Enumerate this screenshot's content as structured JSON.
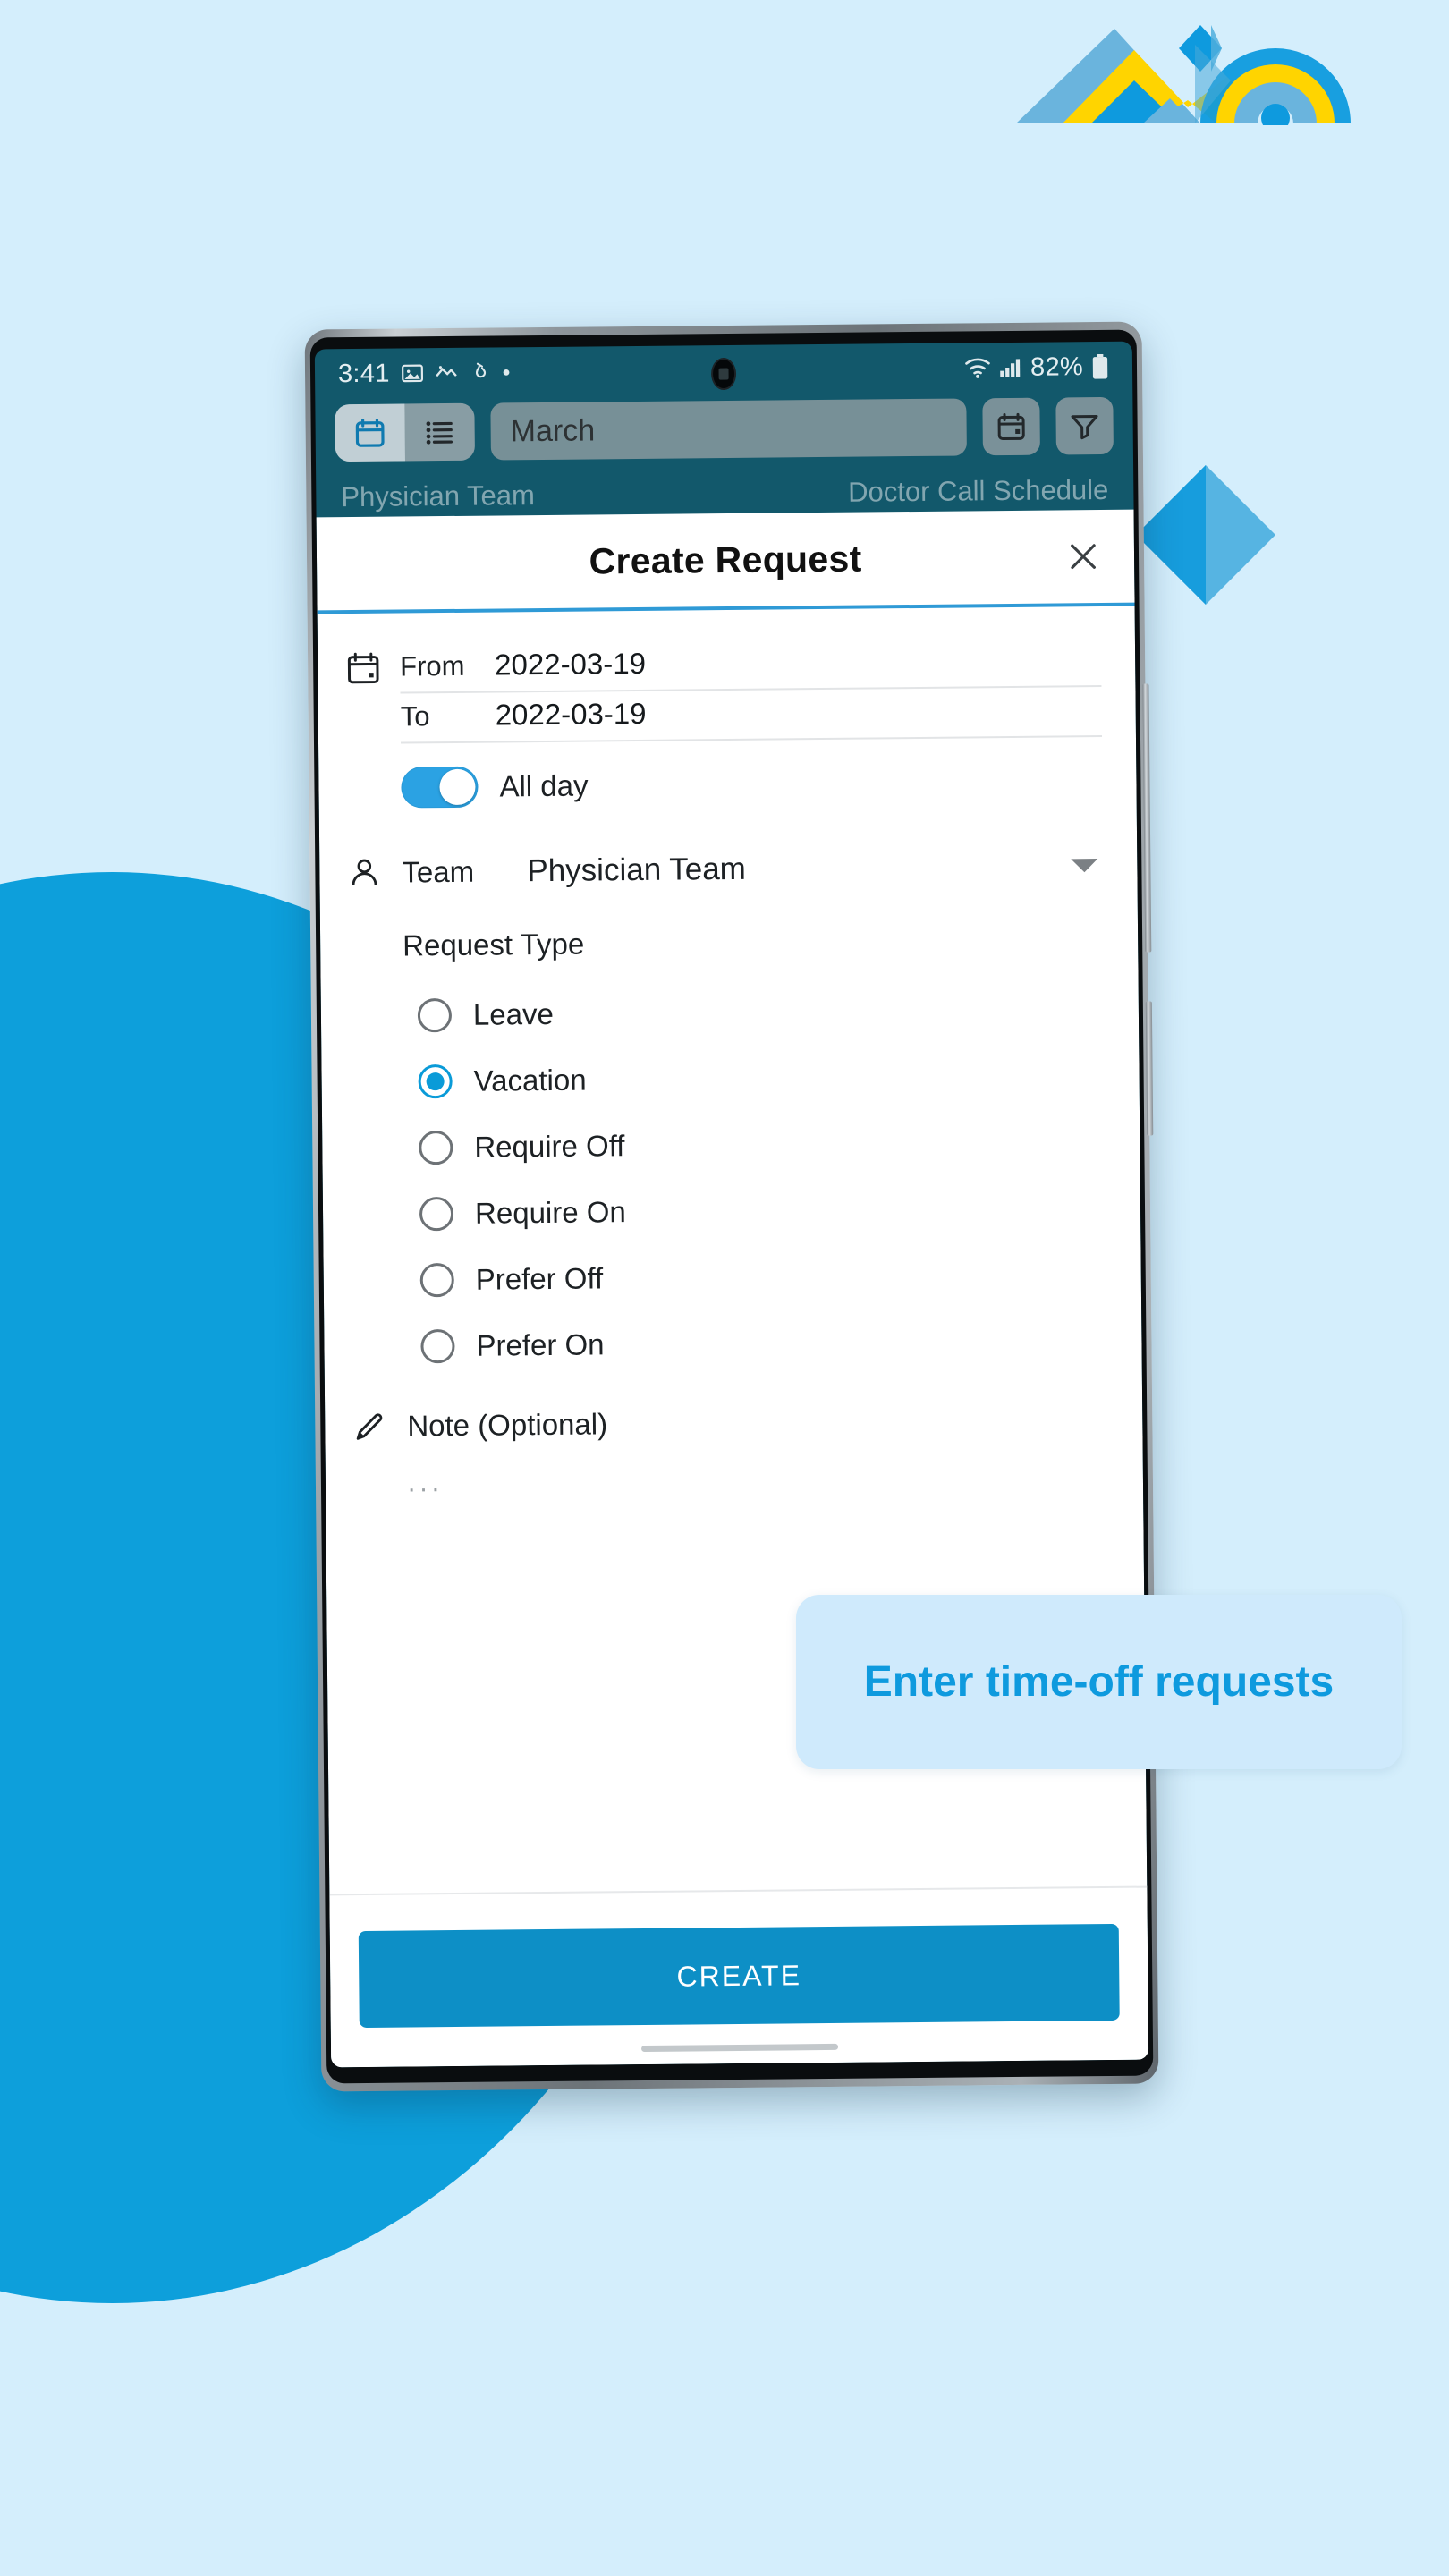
{
  "background": {
    "page_bg": "#d4eefc",
    "blob_color": "#0d9fdb",
    "accent_blue": "#0e9ade",
    "accent_yellow": "#ffd400"
  },
  "logo": {
    "name": "mountain-wave-logo",
    "colors": [
      "#6ab4dd",
      "#ffd400",
      "#0e9ade"
    ]
  },
  "phone": {
    "status_bar": {
      "time": "3:41",
      "icons": [
        "image-icon",
        "photo-editor-icon",
        "alarm-icon",
        "dot-icon"
      ],
      "wifi": "wifi-icon",
      "signal": "cellular-signal-icon",
      "battery_text": "82%",
      "battery": "battery-icon"
    },
    "toolbar": {
      "calendar_view_label": "calendar-view-icon",
      "list_view_label": "list-view-icon",
      "month_value": "March",
      "month_placeholder": "March",
      "date_picker_label": "date-picker-icon",
      "filter_label": "filter-icon"
    },
    "subheader": {
      "left": "Physician Team",
      "right": "Doctor Call Schedule"
    }
  },
  "modal": {
    "title": "Create Request",
    "close_label": "×",
    "date": {
      "icon": "calendar-icon",
      "from_label": "From",
      "from_value": "2022-03-19",
      "to_label": "To",
      "to_value": "2022-03-19"
    },
    "all_day": {
      "label": "All day",
      "enabled": true
    },
    "team": {
      "icon": "person-icon",
      "label": "Team",
      "value": "Physician Team"
    },
    "request_type": {
      "label": "Request Type",
      "selected": "Vacation",
      "options": [
        {
          "label": "Leave",
          "selected": false
        },
        {
          "label": "Vacation",
          "selected": true
        },
        {
          "label": "Require Off",
          "selected": false
        },
        {
          "label": "Require On",
          "selected": false
        },
        {
          "label": "Prefer Off",
          "selected": false
        },
        {
          "label": "Prefer On",
          "selected": false
        }
      ]
    },
    "note": {
      "icon": "pencil-icon",
      "label": "Note (Optional)",
      "value": "...",
      "placeholder": "..."
    },
    "create_button": "CREATE"
  },
  "callout": {
    "text": "Enter time-off requests",
    "bg": "#cfeafc",
    "text_color": "#0e9ade"
  }
}
